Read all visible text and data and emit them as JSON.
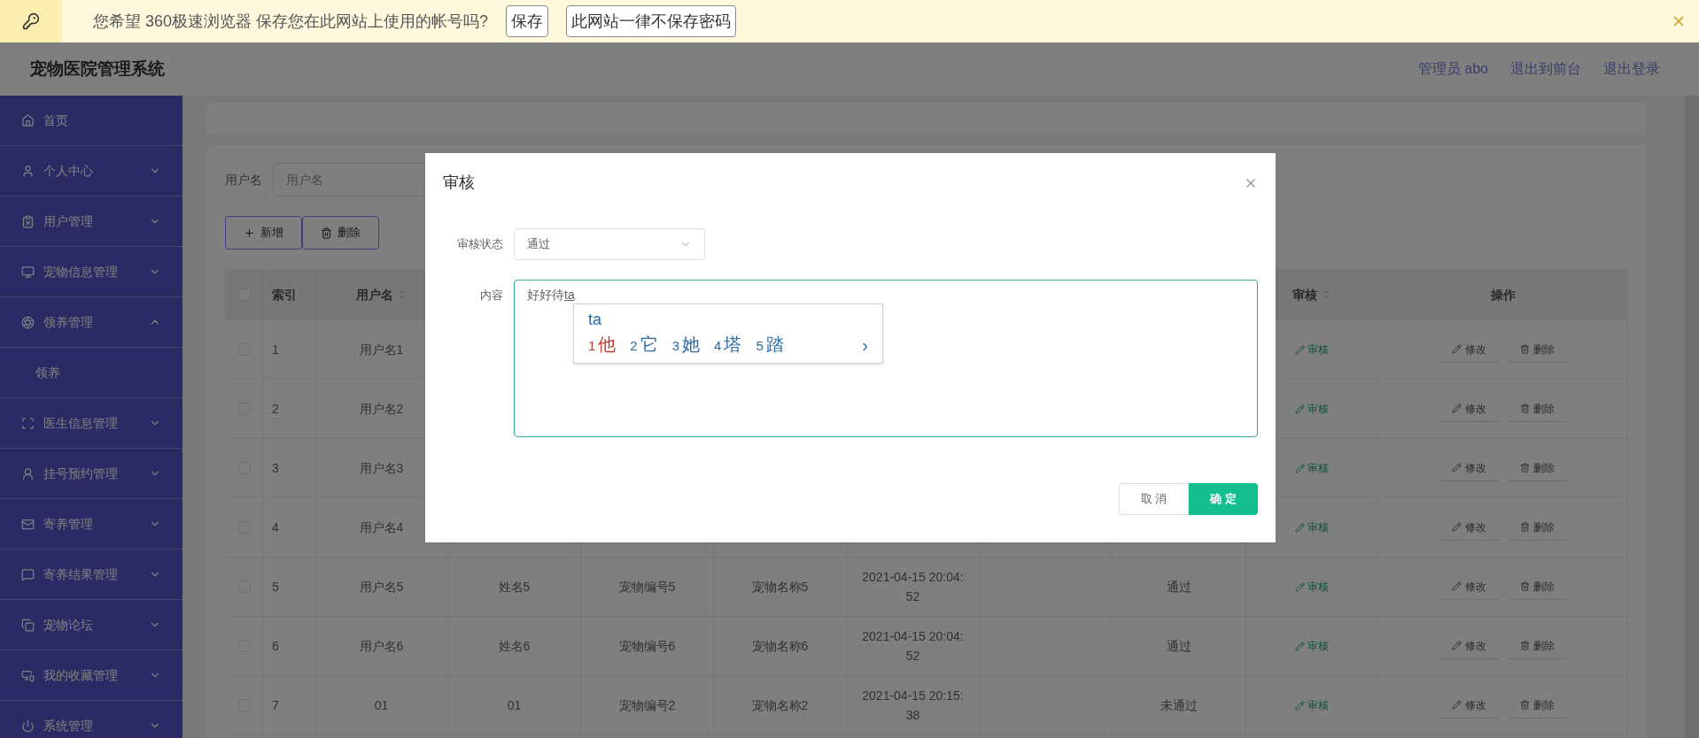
{
  "browser_bar": {
    "message": "您希望 360极速浏览器 保存您在此网站上使用的帐号吗?",
    "buttons": [
      "保存",
      "此网站一律不保存密码"
    ]
  },
  "header": {
    "title": "宠物医院管理系统",
    "links": [
      "管理员 abo",
      "退出到前台",
      "退出登录"
    ]
  },
  "sidebar": {
    "items": [
      {
        "label": "首页",
        "has_children": false
      },
      {
        "label": "个人中心",
        "expanded": false,
        "has_children": true
      },
      {
        "label": "用户管理",
        "expanded": false,
        "has_children": true
      },
      {
        "label": "宠物信息管理",
        "expanded": false,
        "has_children": true
      },
      {
        "label": "领养管理",
        "expanded": true,
        "has_children": true,
        "children": [
          {
            "label": "领养"
          }
        ]
      },
      {
        "label": "医生信息管理",
        "expanded": false,
        "has_children": true
      },
      {
        "label": "挂号预约管理",
        "expanded": false,
        "has_children": true
      },
      {
        "label": "寄养管理",
        "expanded": false,
        "has_children": true
      },
      {
        "label": "寄养结果管理",
        "expanded": false,
        "has_children": true
      },
      {
        "label": "宠物论坛",
        "expanded": false,
        "has_children": true
      },
      {
        "label": "我的收藏管理",
        "expanded": false,
        "has_children": true
      },
      {
        "label": "系统管理",
        "expanded": false,
        "has_children": true
      }
    ]
  },
  "search": {
    "label": "用户名",
    "placeholder": "用户名"
  },
  "toolbar": {
    "add": "新增",
    "delete": "删除"
  },
  "table": {
    "header_checked": false,
    "columns": [
      {
        "label": "索引",
        "sortable": false
      },
      {
        "label": "用户名",
        "sortable": true
      },
      {
        "label": "审核",
        "sortable": true
      },
      {
        "label": "操作",
        "sortable": false
      }
    ],
    "rows": [
      {
        "checked": false,
        "index": "1",
        "username": "用户名1",
        "review": "审核",
        "edit": "修改",
        "delete": "删除"
      },
      {
        "checked": false,
        "index": "2",
        "username": "用户名2",
        "review": "审核",
        "edit": "修改",
        "delete": "删除"
      },
      {
        "checked": false,
        "index": "3",
        "username": "用户名3",
        "review": "审核",
        "edit": "修改",
        "delete": "删除"
      },
      {
        "checked": false,
        "index": "4",
        "username": "用户名4",
        "review": "审核",
        "edit": "修改",
        "delete": "删除"
      },
      {
        "checked": false,
        "index": "5",
        "username": "用户名5",
        "name": "姓名5",
        "pet_no": "宠物编号5",
        "pet_name": "宠物名称5",
        "time": "2021-04-15 20:04:52",
        "status": "通过",
        "review": "审核",
        "edit": "修改",
        "delete": "删除"
      },
      {
        "checked": false,
        "index": "6",
        "username": "用户名6",
        "name": "姓名6",
        "pet_no": "宠物编号6",
        "pet_name": "宠物名称6",
        "time": "2021-04-15 20:04:52",
        "status": "通过",
        "review": "审核",
        "edit": "修改",
        "delete": "删除"
      },
      {
        "checked": false,
        "index": "7",
        "username": "01",
        "name": "01",
        "pet_no": "宠物编号2",
        "pet_name": "宠物名称2",
        "time": "2021-04-15 20:15:38",
        "status": "未通过",
        "review": "审核",
        "edit": "修改",
        "delete": "删除"
      }
    ]
  },
  "dialog": {
    "title": "审核",
    "status_label": "审核状态",
    "status_value": "通过",
    "content_label": "内容",
    "content_value": "好好待",
    "composition": "ta",
    "ime": {
      "input": "ta",
      "candidates": [
        {
          "num": "1",
          "char": "他",
          "selected": true
        },
        {
          "num": "2",
          "char": "它",
          "selected": false
        },
        {
          "num": "3",
          "char": "她",
          "selected": false
        },
        {
          "num": "4",
          "char": "塔",
          "selected": false
        },
        {
          "num": "5",
          "char": "踏",
          "selected": false
        }
      ],
      "next": "›"
    },
    "cancel": "取 消",
    "confirm": "确 定"
  }
}
